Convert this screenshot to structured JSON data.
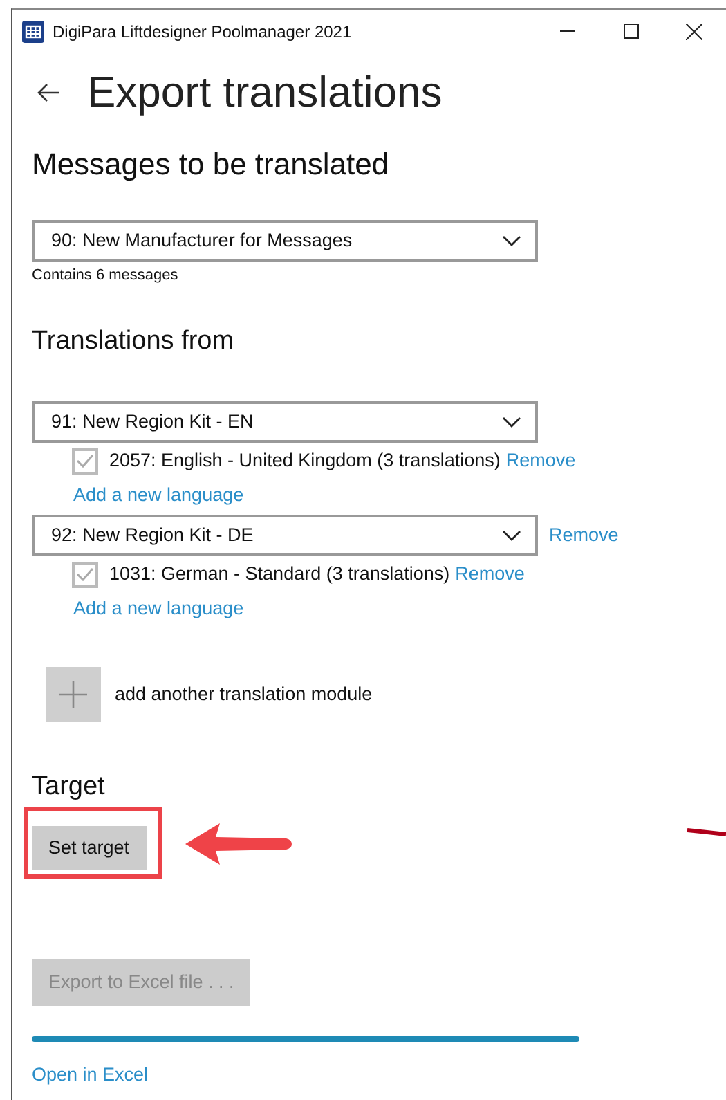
{
  "window": {
    "title": "DigiPara Liftdesigner Poolmanager 2021"
  },
  "page_title": "Export translations",
  "messages": {
    "heading": "Messages to be translated",
    "selected": "90: New Manufacturer for Messages",
    "note": "Contains 6 messages"
  },
  "translations": {
    "heading": "Translations from",
    "modules": [
      {
        "selected": "91: New Region Kit - EN",
        "languages": [
          {
            "label": "2057: English - United Kingdom (3 translations)",
            "checked": true,
            "remove": "Remove"
          }
        ],
        "add_language": "Add a new language"
      },
      {
        "selected": "92: New Region Kit - DE",
        "remove": "Remove",
        "languages": [
          {
            "label": "1031: German - Standard (3 translations)",
            "checked": true,
            "remove": "Remove"
          }
        ],
        "add_language": "Add a new language"
      }
    ],
    "add_module": "add another translation module"
  },
  "target": {
    "heading": "Target",
    "button": "Set target",
    "highlighted": true
  },
  "export": {
    "button": "Export to Excel file . . .",
    "disabled": true,
    "level": 1,
    "open_link": "Open in Excel"
  }
}
